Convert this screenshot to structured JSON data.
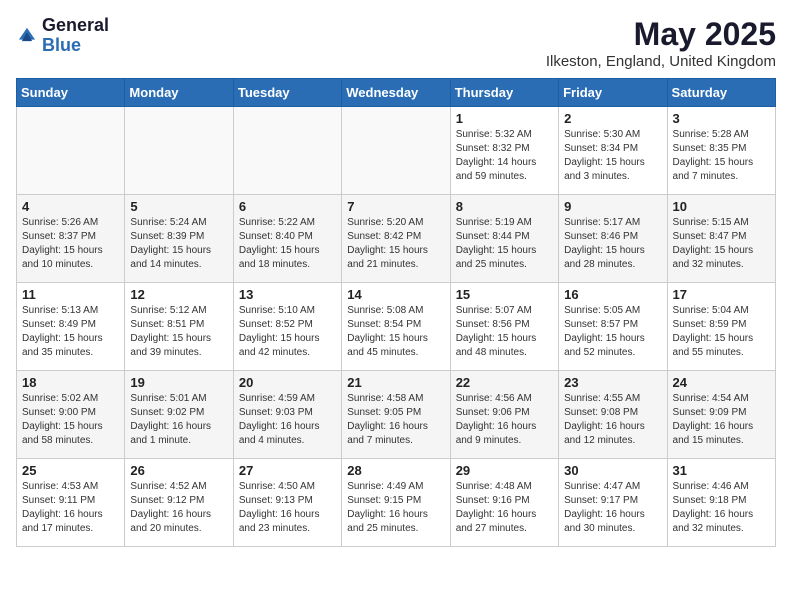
{
  "header": {
    "logo_general": "General",
    "logo_blue": "Blue",
    "month_year": "May 2025",
    "location": "Ilkeston, England, United Kingdom"
  },
  "days_of_week": [
    "Sunday",
    "Monday",
    "Tuesday",
    "Wednesday",
    "Thursday",
    "Friday",
    "Saturday"
  ],
  "weeks": [
    [
      {
        "day": "",
        "info": ""
      },
      {
        "day": "",
        "info": ""
      },
      {
        "day": "",
        "info": ""
      },
      {
        "day": "",
        "info": ""
      },
      {
        "day": "1",
        "info": "Sunrise: 5:32 AM\nSunset: 8:32 PM\nDaylight: 14 hours and 59 minutes."
      },
      {
        "day": "2",
        "info": "Sunrise: 5:30 AM\nSunset: 8:34 PM\nDaylight: 15 hours and 3 minutes."
      },
      {
        "day": "3",
        "info": "Sunrise: 5:28 AM\nSunset: 8:35 PM\nDaylight: 15 hours and 7 minutes."
      }
    ],
    [
      {
        "day": "4",
        "info": "Sunrise: 5:26 AM\nSunset: 8:37 PM\nDaylight: 15 hours and 10 minutes."
      },
      {
        "day": "5",
        "info": "Sunrise: 5:24 AM\nSunset: 8:39 PM\nDaylight: 15 hours and 14 minutes."
      },
      {
        "day": "6",
        "info": "Sunrise: 5:22 AM\nSunset: 8:40 PM\nDaylight: 15 hours and 18 minutes."
      },
      {
        "day": "7",
        "info": "Sunrise: 5:20 AM\nSunset: 8:42 PM\nDaylight: 15 hours and 21 minutes."
      },
      {
        "day": "8",
        "info": "Sunrise: 5:19 AM\nSunset: 8:44 PM\nDaylight: 15 hours and 25 minutes."
      },
      {
        "day": "9",
        "info": "Sunrise: 5:17 AM\nSunset: 8:46 PM\nDaylight: 15 hours and 28 minutes."
      },
      {
        "day": "10",
        "info": "Sunrise: 5:15 AM\nSunset: 8:47 PM\nDaylight: 15 hours and 32 minutes."
      }
    ],
    [
      {
        "day": "11",
        "info": "Sunrise: 5:13 AM\nSunset: 8:49 PM\nDaylight: 15 hours and 35 minutes."
      },
      {
        "day": "12",
        "info": "Sunrise: 5:12 AM\nSunset: 8:51 PM\nDaylight: 15 hours and 39 minutes."
      },
      {
        "day": "13",
        "info": "Sunrise: 5:10 AM\nSunset: 8:52 PM\nDaylight: 15 hours and 42 minutes."
      },
      {
        "day": "14",
        "info": "Sunrise: 5:08 AM\nSunset: 8:54 PM\nDaylight: 15 hours and 45 minutes."
      },
      {
        "day": "15",
        "info": "Sunrise: 5:07 AM\nSunset: 8:56 PM\nDaylight: 15 hours and 48 minutes."
      },
      {
        "day": "16",
        "info": "Sunrise: 5:05 AM\nSunset: 8:57 PM\nDaylight: 15 hours and 52 minutes."
      },
      {
        "day": "17",
        "info": "Sunrise: 5:04 AM\nSunset: 8:59 PM\nDaylight: 15 hours and 55 minutes."
      }
    ],
    [
      {
        "day": "18",
        "info": "Sunrise: 5:02 AM\nSunset: 9:00 PM\nDaylight: 15 hours and 58 minutes."
      },
      {
        "day": "19",
        "info": "Sunrise: 5:01 AM\nSunset: 9:02 PM\nDaylight: 16 hours and 1 minute."
      },
      {
        "day": "20",
        "info": "Sunrise: 4:59 AM\nSunset: 9:03 PM\nDaylight: 16 hours and 4 minutes."
      },
      {
        "day": "21",
        "info": "Sunrise: 4:58 AM\nSunset: 9:05 PM\nDaylight: 16 hours and 7 minutes."
      },
      {
        "day": "22",
        "info": "Sunrise: 4:56 AM\nSunset: 9:06 PM\nDaylight: 16 hours and 9 minutes."
      },
      {
        "day": "23",
        "info": "Sunrise: 4:55 AM\nSunset: 9:08 PM\nDaylight: 16 hours and 12 minutes."
      },
      {
        "day": "24",
        "info": "Sunrise: 4:54 AM\nSunset: 9:09 PM\nDaylight: 16 hours and 15 minutes."
      }
    ],
    [
      {
        "day": "25",
        "info": "Sunrise: 4:53 AM\nSunset: 9:11 PM\nDaylight: 16 hours and 17 minutes."
      },
      {
        "day": "26",
        "info": "Sunrise: 4:52 AM\nSunset: 9:12 PM\nDaylight: 16 hours and 20 minutes."
      },
      {
        "day": "27",
        "info": "Sunrise: 4:50 AM\nSunset: 9:13 PM\nDaylight: 16 hours and 23 minutes."
      },
      {
        "day": "28",
        "info": "Sunrise: 4:49 AM\nSunset: 9:15 PM\nDaylight: 16 hours and 25 minutes."
      },
      {
        "day": "29",
        "info": "Sunrise: 4:48 AM\nSunset: 9:16 PM\nDaylight: 16 hours and 27 minutes."
      },
      {
        "day": "30",
        "info": "Sunrise: 4:47 AM\nSunset: 9:17 PM\nDaylight: 16 hours and 30 minutes."
      },
      {
        "day": "31",
        "info": "Sunrise: 4:46 AM\nSunset: 9:18 PM\nDaylight: 16 hours and 32 minutes."
      }
    ]
  ]
}
